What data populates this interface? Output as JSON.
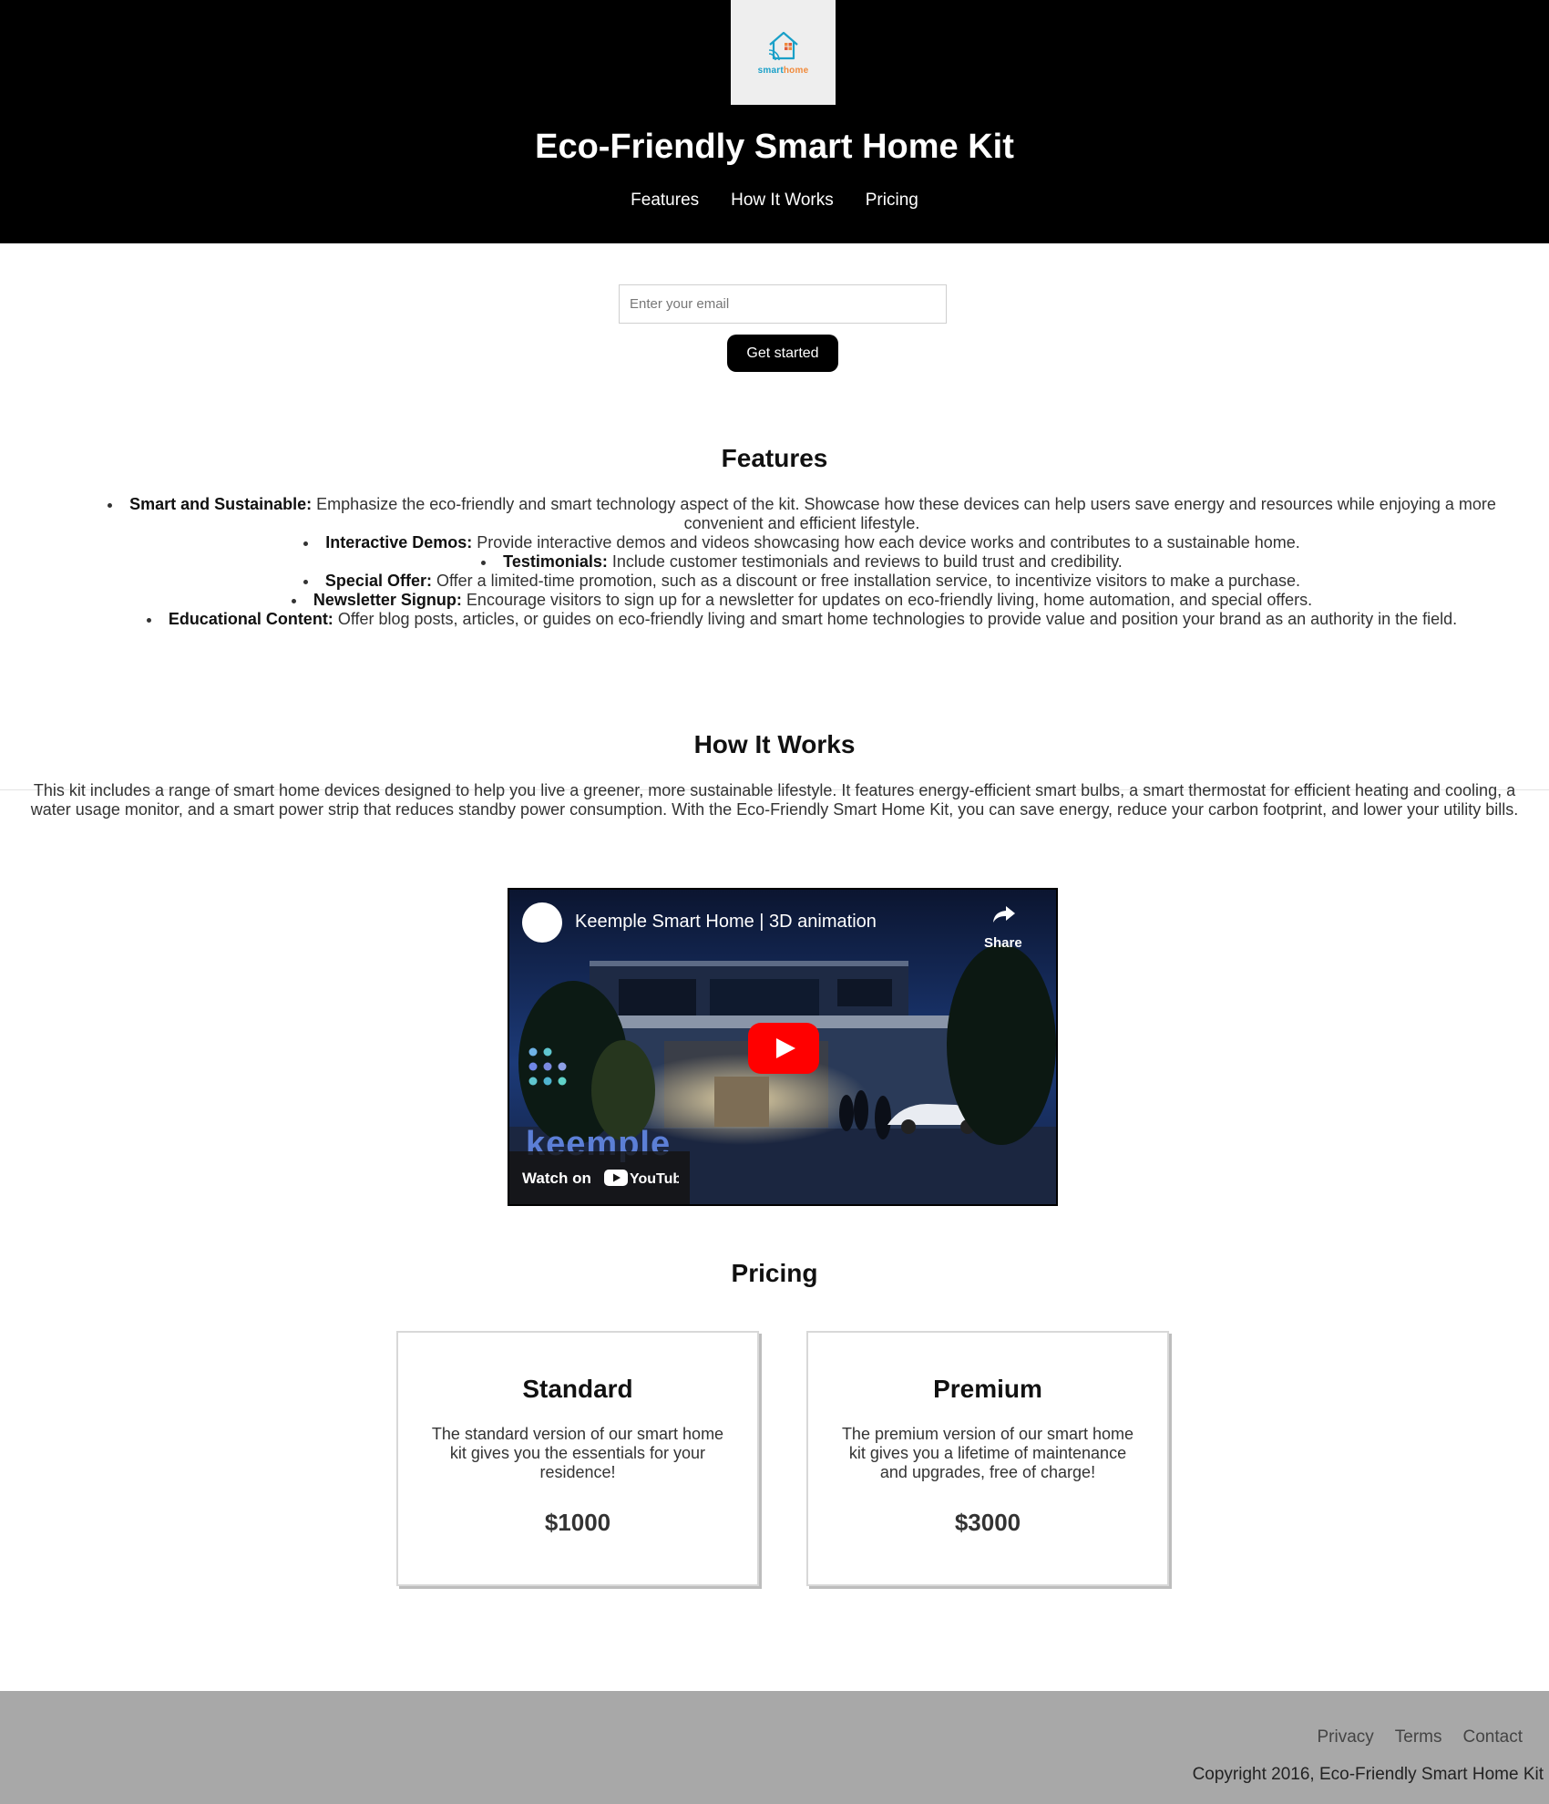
{
  "header": {
    "logo": {
      "text_a": "smart",
      "text_b": "home"
    },
    "title": "Eco-Friendly Smart Home Kit",
    "nav": [
      "Features",
      "How It Works",
      "Pricing"
    ]
  },
  "signup": {
    "email_placeholder": "Enter your email",
    "button_label": "Get started"
  },
  "features": {
    "heading": "Features",
    "items": [
      {
        "title": "Smart and Sustainable:",
        "text": " Emphasize the eco-friendly and smart technology aspect of the kit. Showcase how these devices can help users save energy and resources while enjoying a more convenient and efficient lifestyle."
      },
      {
        "title": "Interactive Demos:",
        "text": " Provide interactive demos and videos showcasing how each device works and contributes to a sustainable home."
      },
      {
        "title": "Testimonials:",
        "text": " Include customer testimonials and reviews to build trust and credibility."
      },
      {
        "title": "Special Offer:",
        "text": " Offer a limited-time promotion, such as a discount or free installation service, to incentivize visitors to make a purchase."
      },
      {
        "title": "Newsletter Signup:",
        "text": " Encourage visitors to sign up for a newsletter for updates on eco-friendly living, home automation, and special offers."
      },
      {
        "title": "Educational Content:",
        "text": " Offer blog posts, articles, or guides on eco-friendly living and smart home technologies to provide value and position your brand as an authority in the field."
      }
    ]
  },
  "how_it_works": {
    "heading": "How It Works",
    "text": "This kit includes a range of smart home devices designed to help you live a greener, more sustainable lifestyle. It features energy-efficient smart bulbs, a smart thermostat for efficient heating and cooling, a water usage monitor, and a smart power strip that reduces standby power consumption. With the Eco-Friendly Smart Home Kit, you can save energy, reduce your carbon footprint, and lower your utility bills.",
    "video": {
      "title": "Keemple Smart Home | 3D animation",
      "share_label": "Share",
      "watch_label": "Watch on",
      "platform": "YouTube",
      "brand_word": "keemple"
    }
  },
  "pricing": {
    "heading": "Pricing",
    "plans": [
      {
        "name": "Standard",
        "description": "The standard version of our smart home kit gives you the essentials for your residence!",
        "price": "$1000"
      },
      {
        "name": "Premium",
        "description": "The premium version of our smart home kit gives you a lifetime of maintenance and upgrades, free of charge!",
        "price": "$3000"
      }
    ]
  },
  "footer": {
    "links": [
      "Privacy",
      "Terms",
      "Contact"
    ],
    "copyright": "Copyright 2016, Eco-Friendly Smart Home Kit"
  }
}
